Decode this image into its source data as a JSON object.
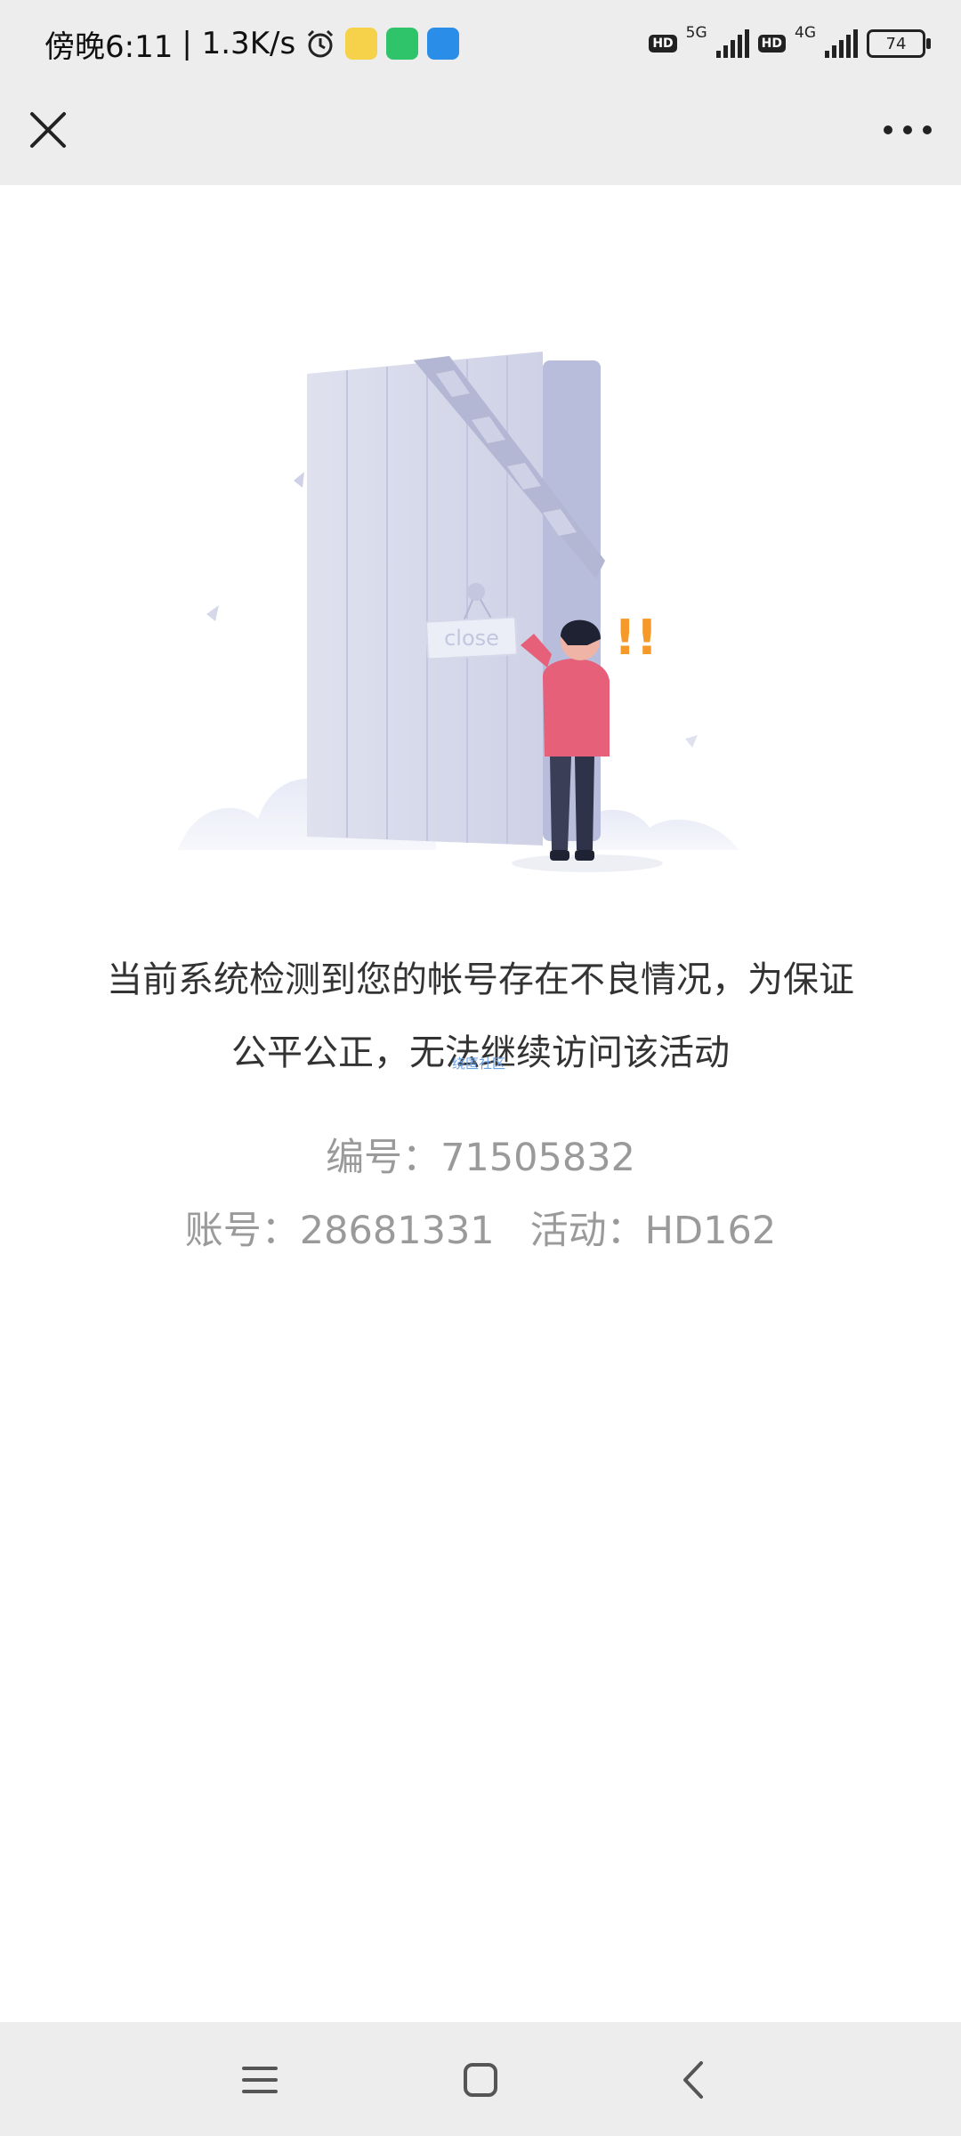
{
  "status_bar": {
    "time": "傍晚6:11",
    "speed": "| 1.3K/s",
    "net1": "5G",
    "net2": "4G",
    "hd_label": "HD",
    "battery": "74"
  },
  "titlebar": {
    "close_icon": "close-icon",
    "more_icon": "more-dots-icon"
  },
  "illustration": {
    "sign_text": "close",
    "alert_text": "!!"
  },
  "message": {
    "line1": "当前系统检测到您的帐号存在不良情况，为保证",
    "line2": "公平公正，无法继续访问该活动",
    "watermark": "绕匿社区"
  },
  "info": {
    "serial_label": "编号：",
    "serial_value": "71505832",
    "account_label": "账号：",
    "account_value": "28681331",
    "activity_label": "活动：",
    "activity_value": "HD162"
  },
  "navbar": {
    "menu_icon": "menu-icon",
    "home_icon": "home-icon",
    "back_icon": "back-icon"
  }
}
